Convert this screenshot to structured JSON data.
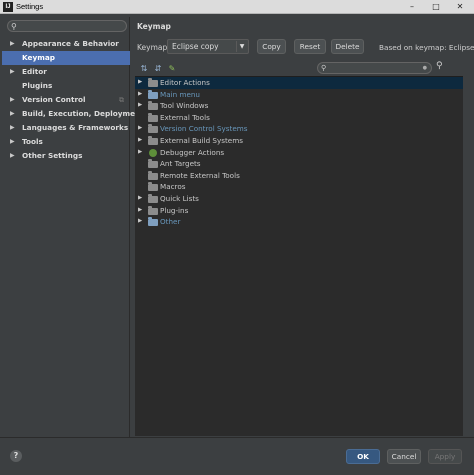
{
  "window": {
    "title": "Settings",
    "app_icon": "IJ"
  },
  "left_panel": {
    "search": {
      "value": "",
      "icon": "search-icon"
    },
    "nav": [
      {
        "label": "Appearance & Behavior",
        "expandable": true,
        "selected": false
      },
      {
        "label": "Keymap",
        "expandable": false,
        "selected": true
      },
      {
        "label": "Editor",
        "expandable": true,
        "selected": false
      },
      {
        "label": "Plugins",
        "expandable": false,
        "selected": false
      },
      {
        "label": "Version Control",
        "expandable": true,
        "selected": false,
        "project_icon": true
      },
      {
        "label": "Build, Execution, Deployment",
        "expandable": true,
        "selected": false
      },
      {
        "label": "Languages & Frameworks",
        "expandable": true,
        "selected": false
      },
      {
        "label": "Tools",
        "expandable": true,
        "selected": false
      },
      {
        "label": "Other Settings",
        "expandable": true,
        "selected": false
      }
    ]
  },
  "keymap": {
    "heading": "Keymap",
    "keymaps_label": "Keymaps:",
    "selected_keymap": "Eclipse copy",
    "buttons": {
      "copy": "Copy",
      "reset": "Reset",
      "delete": "Delete"
    },
    "based_on": "Based on keymap: Eclipse",
    "filter": {
      "value": ""
    },
    "tree": [
      {
        "label": "Editor Actions",
        "arrow": true,
        "icon": "folder-icon",
        "link": false,
        "selected": true
      },
      {
        "label": "Main menu",
        "arrow": true,
        "icon": "folder-blue-icon",
        "link": true,
        "selected": false
      },
      {
        "label": "Tool Windows",
        "arrow": true,
        "icon": "folder-icon",
        "link": false,
        "selected": false
      },
      {
        "label": "External Tools",
        "arrow": false,
        "icon": "folder-icon",
        "link": false,
        "selected": false
      },
      {
        "label": "Version Control Systems",
        "arrow": true,
        "icon": "folder-icon",
        "link": true,
        "selected": false
      },
      {
        "label": "External Build Systems",
        "arrow": true,
        "icon": "build-icon",
        "link": false,
        "selected": false
      },
      {
        "label": "Debugger Actions",
        "arrow": true,
        "icon": "debugger-icon",
        "link": false,
        "selected": false
      },
      {
        "label": "Ant Targets",
        "arrow": false,
        "icon": "folder-icon",
        "link": false,
        "selected": false
      },
      {
        "label": "Remote External Tools",
        "arrow": false,
        "icon": "folder-icon",
        "link": false,
        "selected": false
      },
      {
        "label": "Macros",
        "arrow": false,
        "icon": "folder-icon",
        "link": false,
        "selected": false
      },
      {
        "label": "Quick Lists",
        "arrow": true,
        "icon": "folder-icon",
        "link": false,
        "selected": false
      },
      {
        "label": "Plug-ins",
        "arrow": true,
        "icon": "folder-icon",
        "link": false,
        "selected": false
      },
      {
        "label": "Other",
        "arrow": true,
        "icon": "folder-blue-icon",
        "link": true,
        "selected": false
      }
    ]
  },
  "footer": {
    "help": "?",
    "ok": "OK",
    "cancel": "Cancel",
    "apply": "Apply"
  },
  "colors": {
    "background": "#3c3f41",
    "selection": "#4b6eaf",
    "tree_background": "#2b2b2b",
    "link": "#6897bb"
  }
}
